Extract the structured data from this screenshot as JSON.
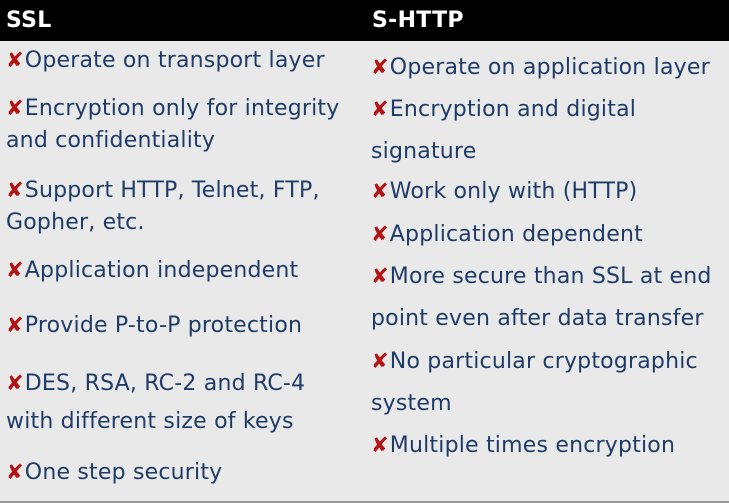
{
  "headers": {
    "left": "SSL",
    "right": "S-HTTP"
  },
  "marker_glyph": "✘",
  "colors": {
    "header_bg": "#000000",
    "header_text": "#ffffff",
    "body_bg": "#e9e9e9",
    "text": "#1f3c68",
    "marker": "#b31313"
  },
  "ssl_items": [
    {
      "line1": "Operate on transport layer",
      "line2": ""
    },
    {
      "line1": "Encryption only for integrity",
      "line2": "and confidentiality"
    },
    {
      "line1": "Support HTTP, Telnet, FTP,",
      "line2": "Gopher, etc."
    },
    {
      "line1": "Application independent",
      "line2": ""
    },
    {
      "line1": "Provide P-to-P protection",
      "line2": ""
    },
    {
      "line1": "DES, RSA, RC-2 and RC-4",
      "line2": "with different size of keys"
    },
    {
      "line1": "One step security",
      "line2": ""
    }
  ],
  "shttp_items": [
    {
      "line1": "Operate on application layer",
      "line2": ""
    },
    {
      "line1": "Encryption and digital",
      "line2": "signature"
    },
    {
      "line1": "Work only with (HTTP)",
      "line2": ""
    },
    {
      "line1": "Application dependent",
      "line2": ""
    },
    {
      "line1": "More secure than SSL at end",
      "line2": "point even after data transfer"
    },
    {
      "line1": "No particular cryptographic",
      "line2": "system"
    },
    {
      "line1": "Multiple times encryption",
      "line2": ""
    }
  ]
}
